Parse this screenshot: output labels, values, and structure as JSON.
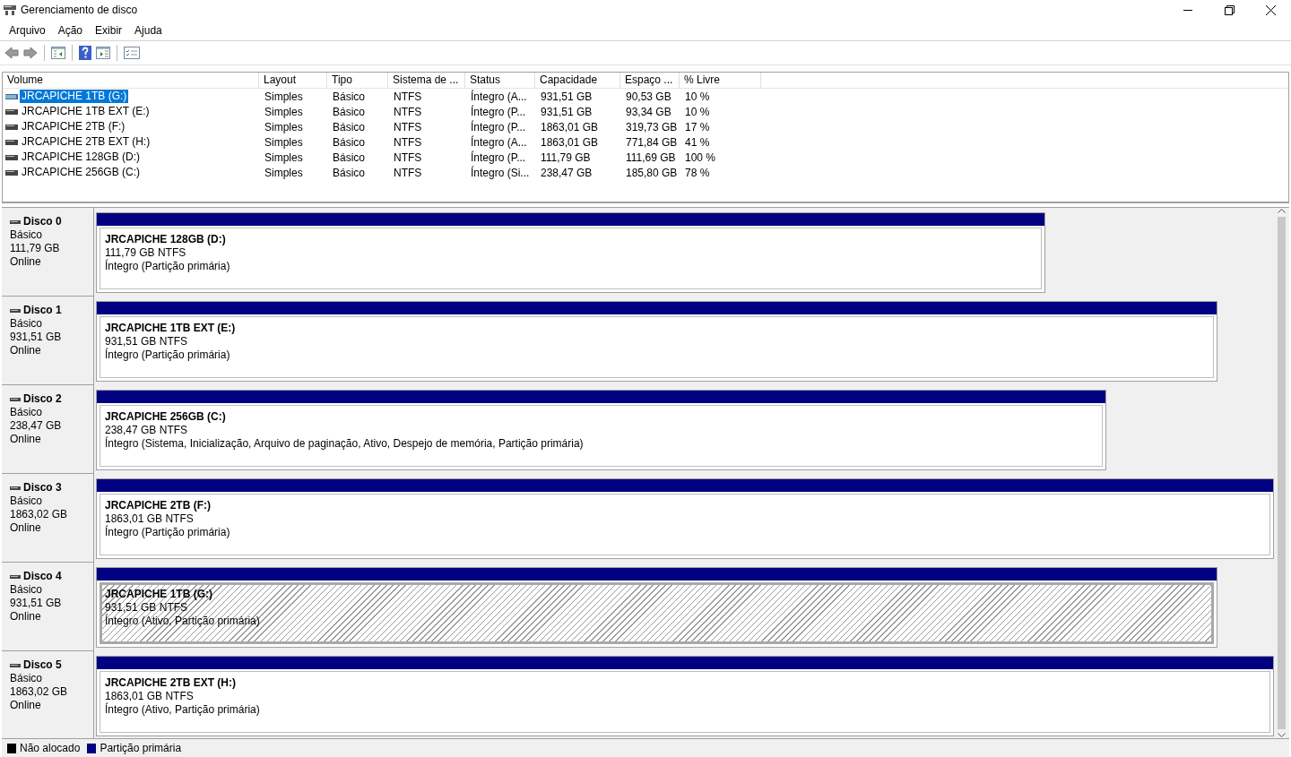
{
  "window": {
    "title": "Gerenciamento de disco"
  },
  "menu": [
    "Arquivo",
    "Ação",
    "Exibir",
    "Ajuda"
  ],
  "table": {
    "columns": [
      "Volume",
      "Layout",
      "Tipo",
      "Sistema de ...",
      "Status",
      "Capacidade",
      "Espaço ...",
      "% Livre"
    ],
    "rows": [
      {
        "selected": true,
        "cells": [
          "JRCAPICHE 1TB (G:)",
          "Simples",
          "Básico",
          "NTFS",
          "Íntegro (A...",
          "931,51 GB",
          "90,53 GB",
          "10 %"
        ]
      },
      {
        "selected": false,
        "cells": [
          "JRCAPICHE 1TB EXT (E:)",
          "Simples",
          "Básico",
          "NTFS",
          "Íntegro (P...",
          "931,51 GB",
          "93,34 GB",
          "10 %"
        ]
      },
      {
        "selected": false,
        "cells": [
          "JRCAPICHE 2TB (F:)",
          "Simples",
          "Básico",
          "NTFS",
          "Íntegro (P...",
          "1863,01 GB",
          "319,73 GB",
          "17 %"
        ]
      },
      {
        "selected": false,
        "cells": [
          "JRCAPICHE 2TB EXT (H:)",
          "Simples",
          "Básico",
          "NTFS",
          "Íntegro (A...",
          "1863,01 GB",
          "771,84 GB",
          "41 %"
        ]
      },
      {
        "selected": false,
        "cells": [
          "JRCAPICHE 128GB (D:)",
          "Simples",
          "Básico",
          "NTFS",
          "Íntegro (P...",
          "111,79 GB",
          "111,69 GB",
          "100 %"
        ]
      },
      {
        "selected": false,
        "cells": [
          "JRCAPICHE 256GB (C:)",
          "Simples",
          "Básico",
          "NTFS",
          "Íntegro (Si...",
          "238,47 GB",
          "185,80 GB",
          "78 %"
        ]
      }
    ]
  },
  "disks": [
    {
      "name": "Disco 0",
      "type": "Básico",
      "size": "111,79 GB",
      "state": "Online",
      "partition": {
        "selected": false,
        "label": "JRCAPICHE 128GB  (D:)",
        "size": "111,79 GB NTFS",
        "status": "Íntegro (Partição primária)"
      }
    },
    {
      "name": "Disco 1",
      "type": "Básico",
      "size": "931,51 GB",
      "state": "Online",
      "partition": {
        "selected": false,
        "label": "JRCAPICHE 1TB EXT  (E:)",
        "size": "931,51 GB NTFS",
        "status": "Íntegro (Partição primária)"
      }
    },
    {
      "name": "Disco 2",
      "type": "Básico",
      "size": "238,47 GB",
      "state": "Online",
      "partition": {
        "selected": false,
        "label": "JRCAPICHE 256GB  (C:)",
        "size": "238,47 GB NTFS",
        "status": "Íntegro (Sistema, Inicialização, Arquivo de paginação, Ativo, Despejo de memória, Partição primária)"
      }
    },
    {
      "name": "Disco 3",
      "type": "Básico",
      "size": "1863,02 GB",
      "state": "Online",
      "partition": {
        "selected": false,
        "label": "JRCAPICHE 2TB  (F:)",
        "size": "1863,01 GB NTFS",
        "status": "Íntegro (Partição primária)"
      }
    },
    {
      "name": "Disco 4",
      "type": "Básico",
      "size": "931,51 GB",
      "state": "Online",
      "partition": {
        "selected": true,
        "label": "JRCAPICHE 1TB  (G:)",
        "size": "931,51 GB NTFS",
        "status": "Íntegro (Ativo, Partição primária)"
      }
    },
    {
      "name": "Disco 5",
      "type": "Básico",
      "size": "1863,02 GB",
      "state": "Online",
      "partition": {
        "selected": false,
        "label": "JRCAPICHE 2TB EXT  (H:)",
        "size": "1863,01 GB NTFS",
        "status": "Íntegro (Ativo, Partição primária)"
      }
    }
  ],
  "legend": [
    {
      "label": "Não alocado",
      "color": "#000000"
    },
    {
      "label": "Partição primária",
      "color": "#000080"
    }
  ]
}
